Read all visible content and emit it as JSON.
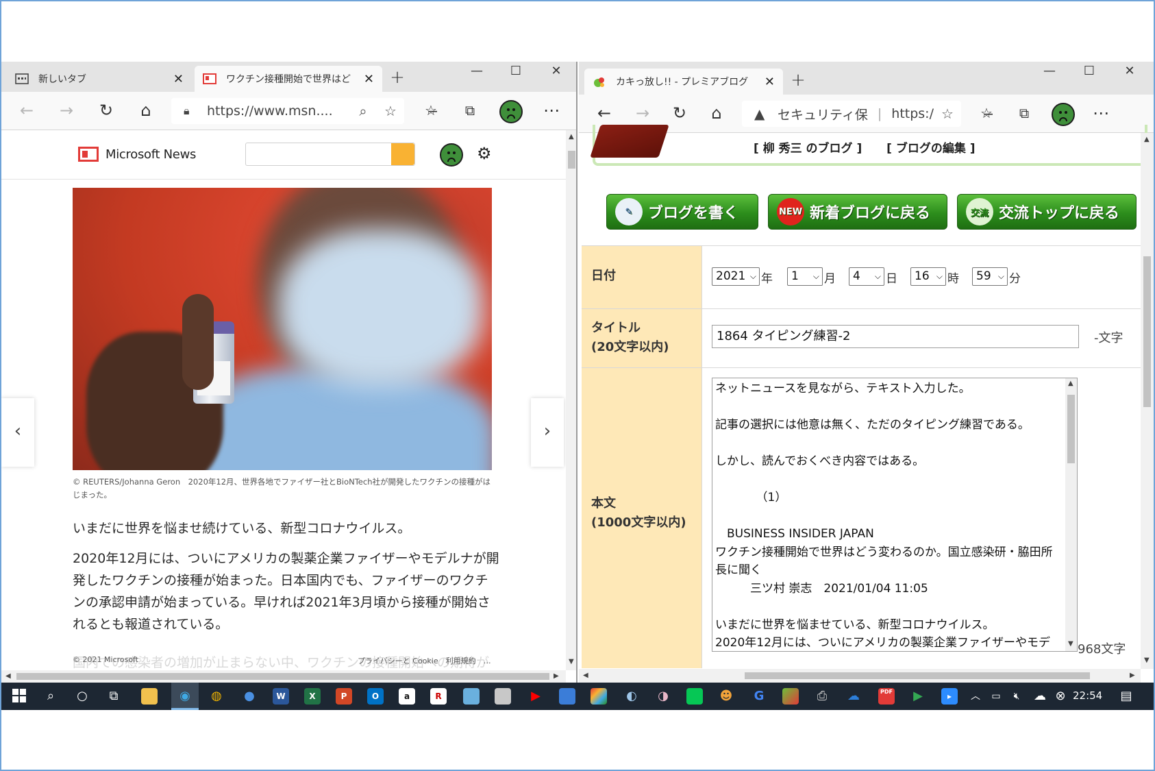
{
  "left_browser": {
    "tabs": [
      {
        "label": "新しいタブ",
        "active": false
      },
      {
        "label": "ワクチン接種開始で世界はど",
        "active": true
      }
    ],
    "address_url": "https://www.msn....",
    "site_name": "Microsoft News",
    "search_placeholder": "",
    "image_caption": "© REUTERS/Johanna Geron　2020年12月、世界各地でファイザー社とBioNTech社が開発したワクチンの接種がはじまった。",
    "article_paragraphs": [
      "いまだに世界を悩ませ続けている、新型コロナウイルス。",
      "2020年12月には、ついにアメリカの製薬企業ファイザーやモデルナが開発したワクチンの接種が始まった。日本国内でも、ファイザーのワクチンの承認申請が始まっている。早ければ2021年3月頃から接種が開始されるとも報道されている。"
    ],
    "ghost_text": "国内での感染者の増加が止まらない中、ワクチンの接種開始への期待が",
    "footer_copyright": "© 2021 Microsoft",
    "footer_links": "プライバシーと Cookie　利用規約　…"
  },
  "right_browser": {
    "tab_label": "カキっ放し!! - プレミアブログ",
    "security_warning": "セキュリティ保",
    "address_url": "https://...",
    "blog_links": [
      "[ 柳 秀三 のブログ ]",
      "[ ブログの編集 ]"
    ],
    "buttons": [
      "ブログを書く",
      "新着ブログに戻る",
      "交流トップに戻る"
    ],
    "new_badge": "NEW",
    "exchange_badge": "交流",
    "form": {
      "date_label": "日付",
      "year": "2021",
      "year_unit": "年",
      "month": "1",
      "month_unit": "月",
      "day": "4",
      "day_unit": "日",
      "hour": "16",
      "hour_unit": "時",
      "minute": "59",
      "minute_unit": "分",
      "title_label": "タイトル",
      "title_limit": "(20文字以内)",
      "title_value": "1864 タイピング練習-2",
      "title_counter": "-文字",
      "body_label": "本文",
      "body_limit": "(1000文字以内)",
      "body_text": "ネットニュースを見ながら、テキスト入力した。\n\n記事の選択には他意は無く、ただのタイピング練習である。\n\nしかし、読んでおくべき内容ではある。\n\n　　　　（1）\n\n　BUSINESS INSIDER JAPAN\nワクチン接種開始で世界はどう変わるのか。国立感染研・脇田所長に聞く\n　　　三ツ村 崇志　2021/01/04 11:05\n\nいまだに世界を悩ませている、新型コロナウイルス。\n2020年12月には、ついにアメリカの製薬企業ファイザーやモデ",
      "body_counter": "968文字"
    }
  },
  "taskbar": {
    "clock": "22:54"
  },
  "colors": {
    "frame_border": "#6fa3d8",
    "msn_red": "#e23b38",
    "search_go": "#f9b233",
    "form_label_bg": "#fee8b7",
    "green_button": "#2c8d1c",
    "taskbar_bg": "#1d2733"
  }
}
